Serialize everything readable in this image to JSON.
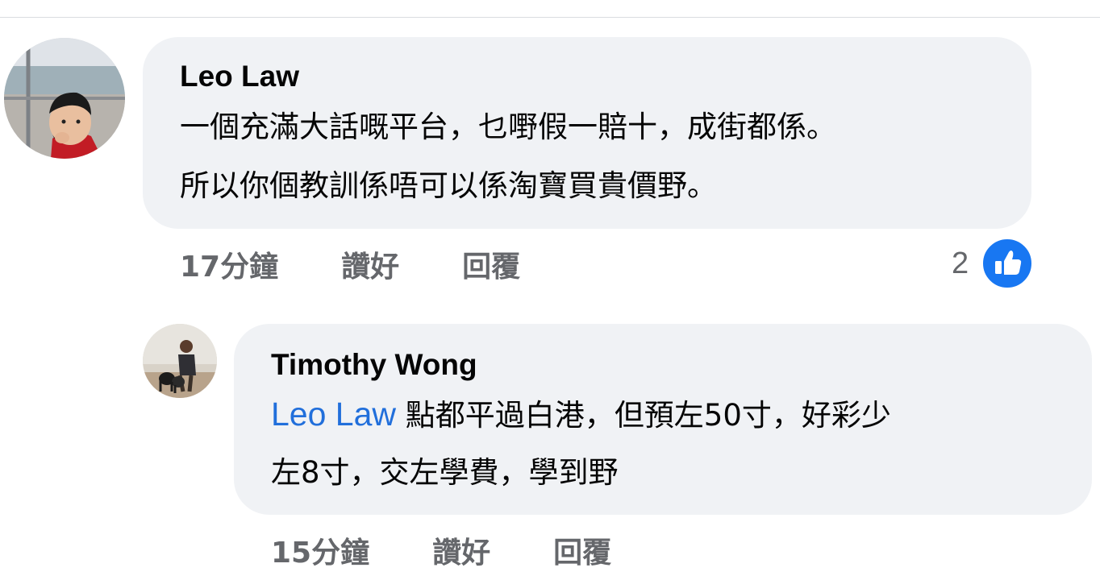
{
  "comments": [
    {
      "author": "Leo Law",
      "lines": [
        "一個充滿大話嘅平台，乜嘢假一賠十，成街都係。",
        "所以你個教訓係唔可以係淘寶買貴價野。"
      ],
      "time": "17分鐘",
      "like_label": "讚好",
      "reply_label": "回覆",
      "reaction_count": "2",
      "reaction_icon": "thumbs-up-icon"
    }
  ],
  "replies": [
    {
      "author": "Timothy Wong",
      "mention": "Leo Law",
      "line1": " 點都平過白港，但預左50寸，好彩少",
      "line2": "左8寸，交左學費，學到野",
      "time": "15分鐘",
      "like_label": "讚好",
      "reply_label": "回覆"
    }
  ],
  "colors": {
    "bubble": "#f0f2f5",
    "mention": "#216fdb",
    "meta": "#65676b",
    "like_blue": "#1877f2"
  }
}
